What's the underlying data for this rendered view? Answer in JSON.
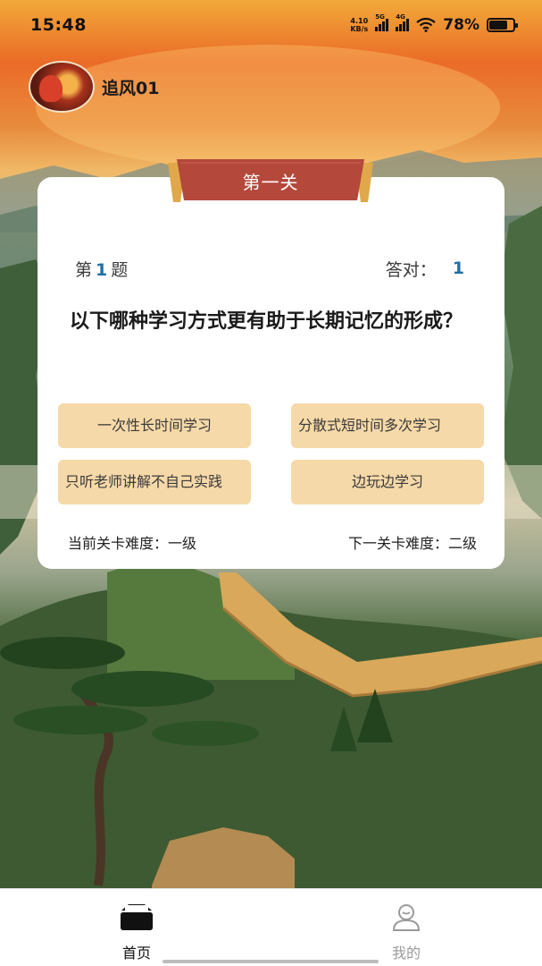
{
  "status_bar": {
    "time": "15:48",
    "net_speed_value": "4.10",
    "net_speed_unit": "KB/s",
    "sim1_label": "5G",
    "sim2_label": "4G",
    "battery_percent": "78%",
    "battery_level": 0.78
  },
  "user": {
    "name": "追风01"
  },
  "quiz": {
    "level_title": "第一关",
    "question_prefix": "第",
    "question_number": "1",
    "question_suffix": "题",
    "correct_label": "答对：",
    "correct_count": "1",
    "question_text": "以下哪种学习方式更有助于长期记忆的形成？",
    "options": [
      "一次性长时间学习",
      "分散式短时间多次学习",
      "只听老师讲解不自己实践",
      "边玩边学习"
    ],
    "current_difficulty": "当前关卡难度：一级",
    "next_difficulty": "下一关卡难度：二级"
  },
  "tabbar": {
    "tabs": [
      {
        "label": "首页",
        "icon": "home-icon",
        "active": true
      },
      {
        "label": "我的",
        "icon": "profile-icon",
        "active": false
      }
    ]
  },
  "colors": {
    "accent_blue": "#1f6fa5",
    "option_bg": "#f6d9a8",
    "ribbon_red": "#b4483b",
    "ribbon_gold": "#e0a84a"
  }
}
